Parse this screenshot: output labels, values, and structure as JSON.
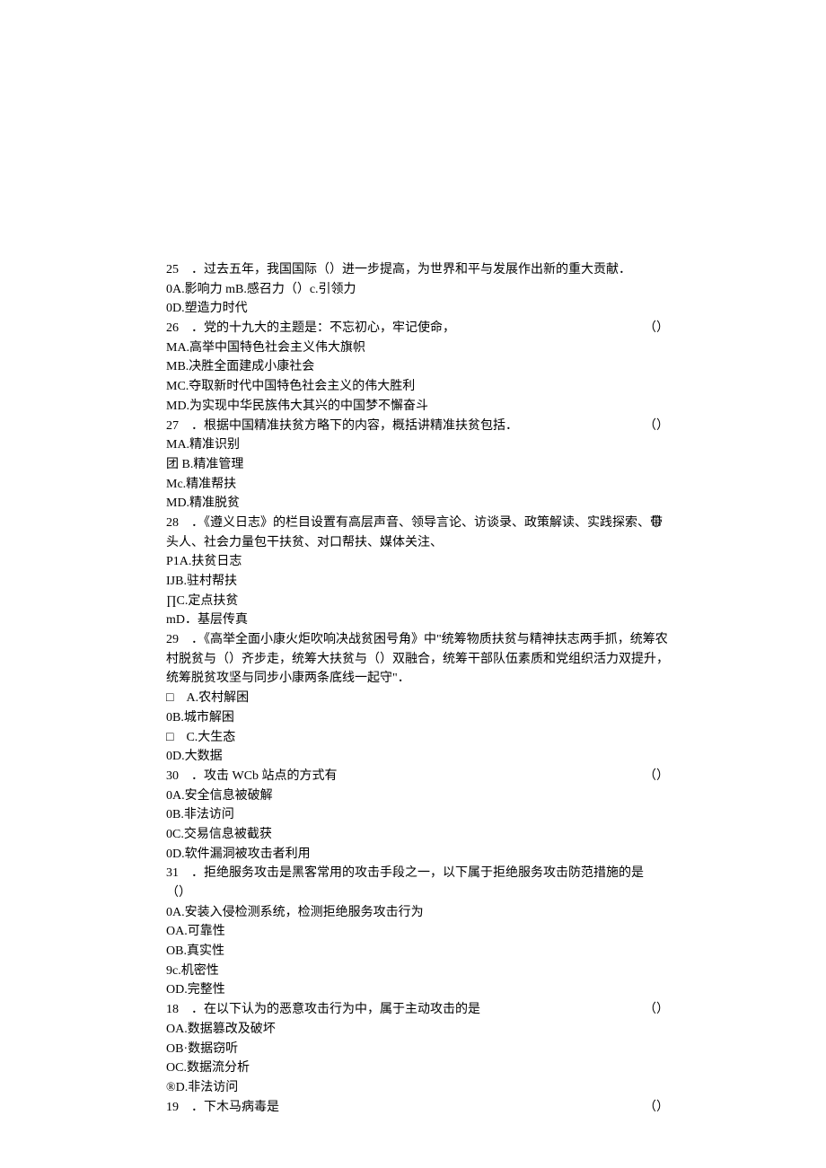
{
  "questions": [
    {
      "num": "25",
      "text": "．过去五年，我国国际（）进一步提高，为世界和平与发展作出新的重大贡献．",
      "paren": "",
      "options": [
        "0A.影响力 mB.感召力（）c.引领力",
        "0D.塑造力时代"
      ]
    },
    {
      "num": "26",
      "text": "．党的十九大的主题是：不忘初心，牢记使命，",
      "paren": "（）",
      "options": [
        "MA.高举中国特色社会主义伟大旗帜",
        "MB.决胜全面建成小康社会",
        "MC.夺取新时代中国特色社会主义的伟大胜利",
        "MD.为实现中华民族伟大其兴的中国梦不懈奋斗"
      ]
    },
    {
      "num": "27",
      "text": "．根据中国精准扶贫方略下的内容，概括讲精准扶贫包括．",
      "paren": "（）",
      "options": [
        "MA.精准识别",
        "团 B.精准管理",
        "Mc.精准帮扶",
        "MD.精准脱贫"
      ]
    },
    {
      "num": "28",
      "text": "．《遵义日志》的栏目设置有高层声音、领导言论、访谈录、政策解读、实践探索、带头人、社会力量包干扶贫、对口帮扶、媒体关注、",
      "paren": "（）",
      "options": [
        "P1A.扶贫日志",
        "IJB.驻村帮扶",
        "∏C.定点扶贫",
        "mD．基层传真"
      ]
    },
    {
      "num": "29",
      "text": "．《高举全面小康火炬吹响决战贫困号角》中\"统筹物质扶贫与精神扶志两手抓，统筹农村脱贫与（）齐步走，统筹大扶贫与（）双融合，统筹干部队伍素质和党组织活力双提升，统筹脱贫攻坚与同步小康两条底线一起守\"．",
      "paren": "",
      "options": [
        "□ A.农村解困",
        "0B.城市解困",
        "□ C.大生态",
        "0D.大数据"
      ]
    },
    {
      "num": "30",
      "text": "．攻击 WCb 站点的方式有",
      "paren": "（）",
      "options": [
        "0A.安全信息被破解",
        "0B.非法访问",
        "0C.交易信息被截获",
        "0D.软件漏洞被攻击者利用"
      ]
    },
    {
      "num": "31",
      "text": "．拒绝服务攻击是黑客常用的攻击手段之一，以下属于拒绝服务攻击防范措施的是 （）",
      "paren": "",
      "options": [
        "0A.安装入侵检测系统，检测拒绝服务攻击行为",
        "OA.可靠性",
        "OB.真实性",
        "9c.机密性",
        "OD.完整性"
      ]
    },
    {
      "num": "18",
      "text": "．在以下认为的恶意攻击行为中，属于主动攻击的是",
      "paren": "（）",
      "options": [
        "OA.数据篡改及破坏",
        "OB·数据窃听",
        "OC.数据流分析",
        "®D.非法访问"
      ]
    },
    {
      "num": "19",
      "text": "．下木马病毒是",
      "paren": "（）",
      "options": []
    }
  ]
}
